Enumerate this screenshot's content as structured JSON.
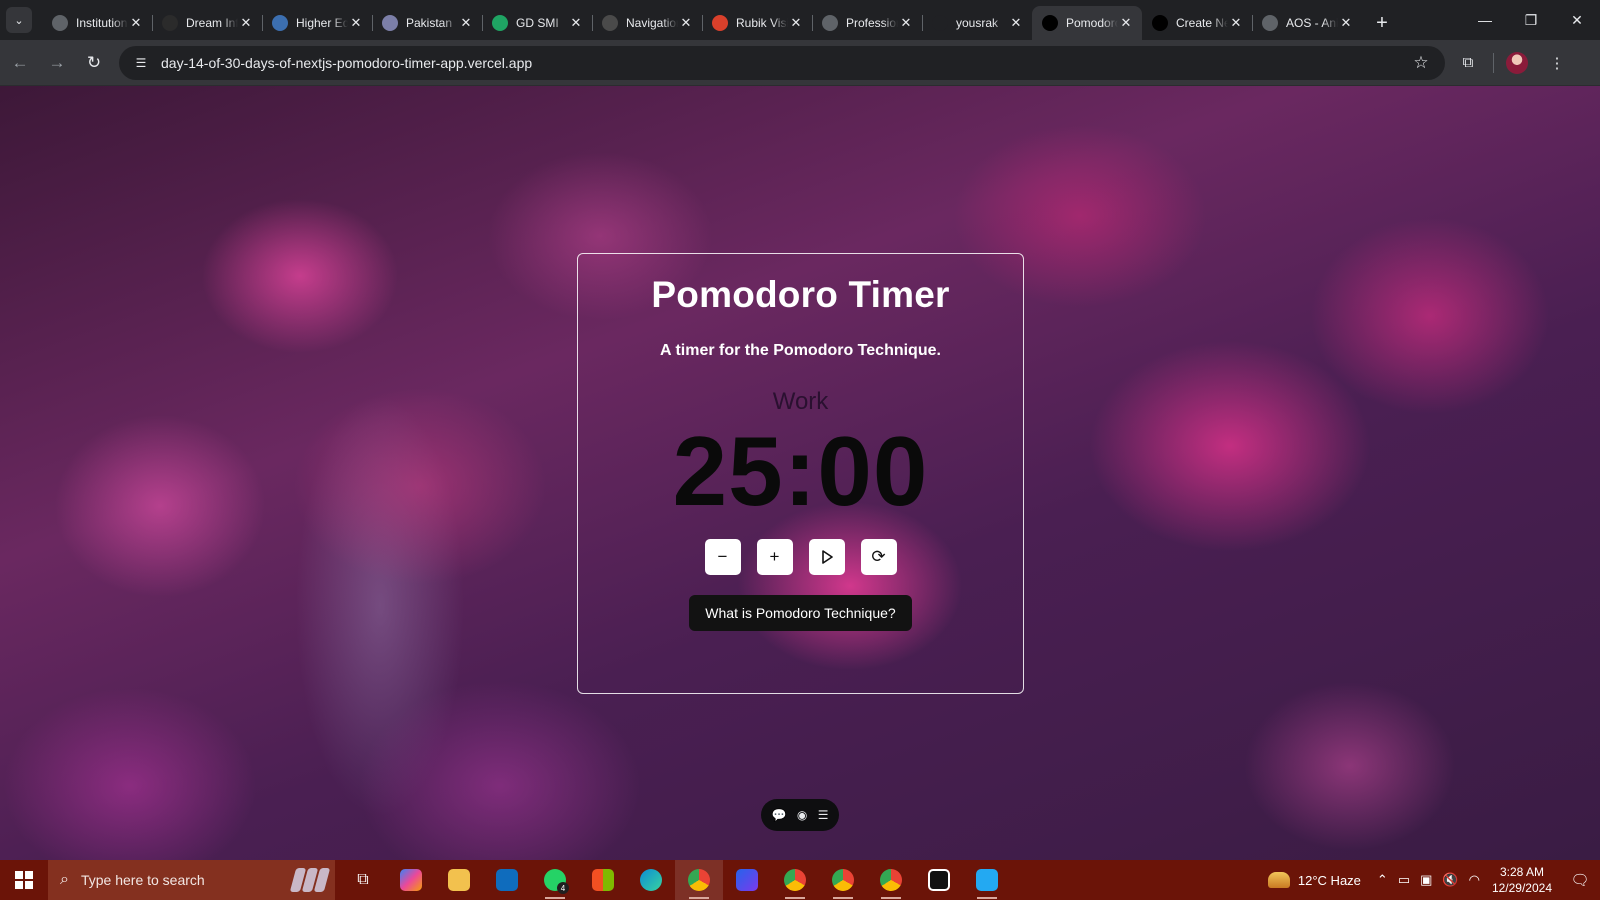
{
  "browser": {
    "tabs": [
      {
        "title": "Institutions",
        "icon": "slash-favicon",
        "color": "#5f6368"
      },
      {
        "title": "Dream Info",
        "icon": "id-favicon",
        "color": "#2b2b2b"
      },
      {
        "title": "Higher Education",
        "icon": "globe-favicon",
        "color": "#3c6fb0"
      },
      {
        "title": "Pakistan",
        "icon": "document-favicon",
        "color": "#7c7fa8"
      },
      {
        "title": "GD SMI",
        "icon": "drive-favicon",
        "color": "#1fa463"
      },
      {
        "title": "Navigation",
        "icon": "slash-favicon",
        "color": "#4a4a4a"
      },
      {
        "title": "Rubik Vision",
        "icon": "rubik-favicon",
        "color": "#d9402b"
      },
      {
        "title": "Professional",
        "icon": "openai-favicon",
        "color": "#5f6368"
      },
      {
        "title": "yousrak",
        "icon": "github-favicon",
        "color": "#202124"
      },
      {
        "title": "Pomodoro",
        "icon": "vercel-favicon",
        "color": "#000000",
        "active": true
      },
      {
        "title": "Create Next App",
        "icon": "vercel-favicon",
        "color": "#000000"
      },
      {
        "title": "AOS - Animate On Scroll",
        "icon": "globe-favicon",
        "color": "#5f6368"
      }
    ],
    "url": "day-14-of-30-days-of-nextjs-pomodoro-timer-app.vercel.app"
  },
  "app": {
    "title": "Pomodoro Timer",
    "subtitle": "A timer for the Pomodoro Technique.",
    "mode": "Work",
    "time": "25:00",
    "info_button": "What is Pomodoro Technique?"
  },
  "taskbar": {
    "search_placeholder": "Type here to search",
    "whatsapp_badge": "4",
    "weather": "12°C  Haze",
    "time": "3:28 AM",
    "date": "12/29/2024"
  }
}
